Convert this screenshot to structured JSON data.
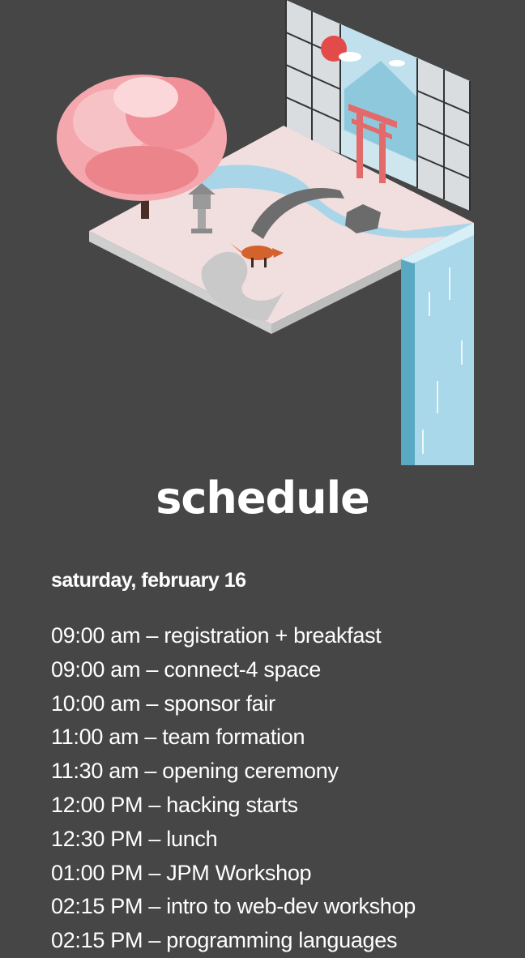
{
  "page": {
    "background": "#464646",
    "text_color": "#ffffff"
  },
  "hero": {
    "illustration": "isometric japanese garden with cherry blossom tree, stone lantern, bridge, fox, torii gate and waterfall",
    "icons": [
      "cherry-blossom-tree",
      "stone-lantern",
      "bridge",
      "fox",
      "torii-gate",
      "waterfall",
      "rising-sun"
    ]
  },
  "title": "schedule",
  "day": {
    "heading": "saturday, february 16",
    "events": [
      {
        "time": "09:00 am",
        "label": "registration + breakfast"
      },
      {
        "time": "09:00 am",
        "label": "connect-4 space"
      },
      {
        "time": "10:00 am",
        "label": "sponsor fair"
      },
      {
        "time": "11:00 am",
        "label": "team formation"
      },
      {
        "time": "11:30 am",
        "label": "opening ceremony"
      },
      {
        "time": "12:00 PM",
        "label": "hacking starts"
      },
      {
        "time": "12:30 PM",
        "label": "lunch"
      },
      {
        "time": "01:00 PM",
        "label": "JPM Workshop"
      },
      {
        "time": "02:15 PM",
        "label": "intro to web-dev workshop"
      },
      {
        "time": "02:15 PM",
        "label": "programming languages"
      }
    ]
  }
}
